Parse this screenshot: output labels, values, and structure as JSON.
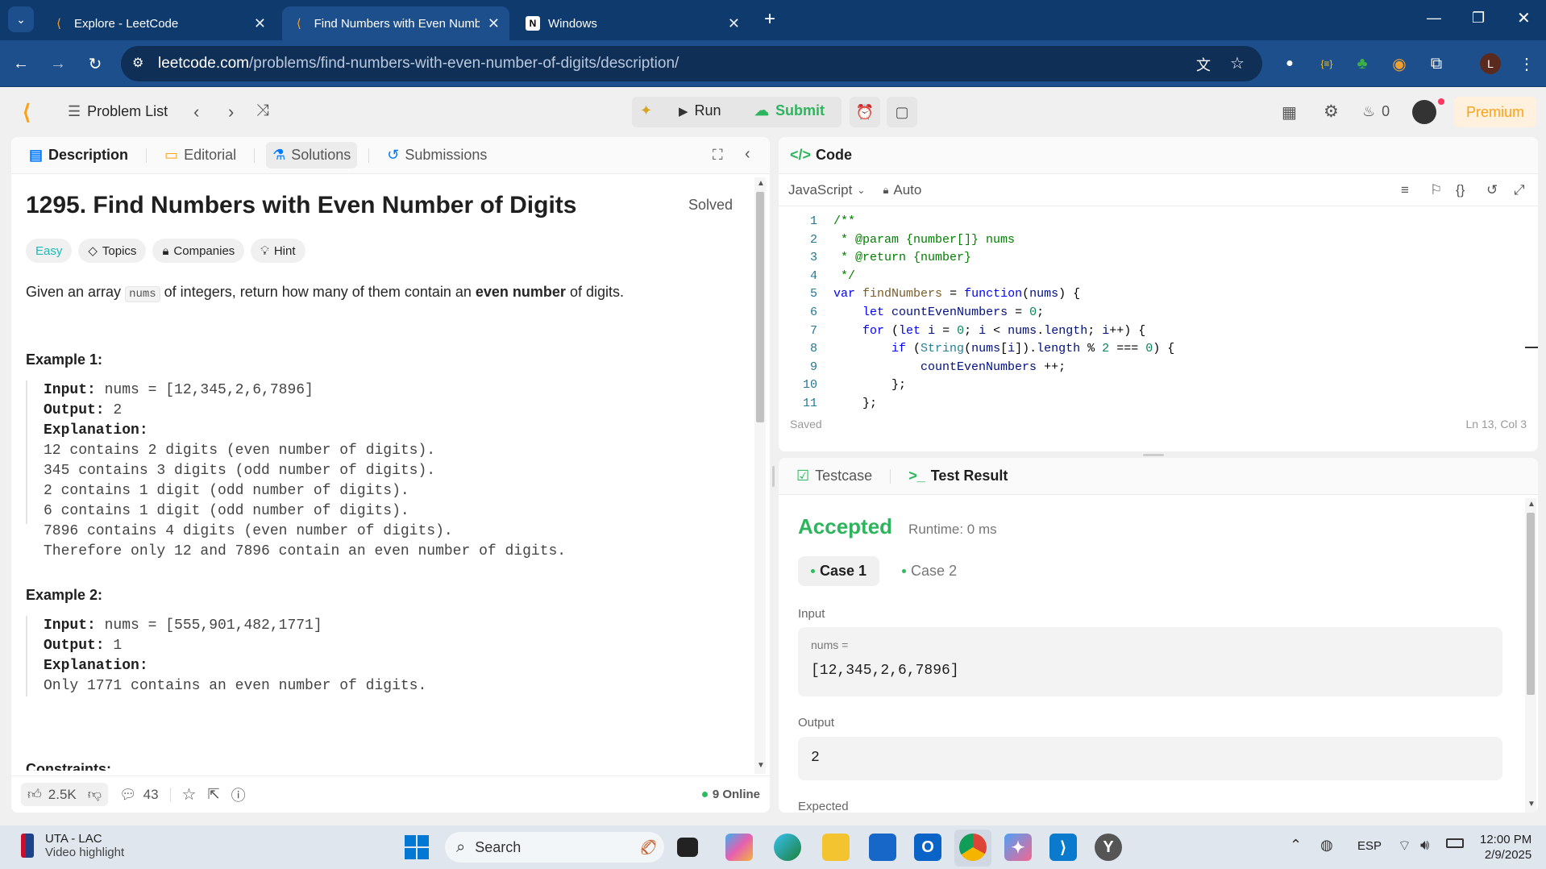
{
  "browser": {
    "tabs": [
      {
        "title": "Explore - LeetCode"
      },
      {
        "title": "Find Numbers with Even Numb"
      },
      {
        "title": "Windows"
      }
    ],
    "url_host": "leetcode.com",
    "url_path": "/problems/find-numbers-with-even-number-of-digits/description/",
    "profile_initial": "L"
  },
  "header": {
    "problem_list": "Problem List",
    "run": "Run",
    "submit": "Submit",
    "streak": "0",
    "premium": "Premium"
  },
  "left_tabs": {
    "description": "Description",
    "editorial": "Editorial",
    "solutions": "Solutions",
    "submissions": "Submissions"
  },
  "problem": {
    "title": "1295. Find Numbers with Even Number of Digits",
    "status": "Solved",
    "difficulty": "Easy",
    "topics": "Topics",
    "companies": "Companies",
    "hint": "Hint",
    "desc_before": "Given an array ",
    "desc_code": "nums",
    "desc_mid": " of integers, return how many of them contain an ",
    "desc_bold": "even number",
    "desc_after": " of digits.",
    "example1_title": "Example 1:",
    "example1": {
      "input_label": "Input:",
      "input": " nums = [12,345,2,6,7896]",
      "output_label": "Output:",
      "output": " 2",
      "explanation_label": "Explanation:",
      "explanation": "12 contains 2 digits (even number of digits). \n345 contains 3 digits (odd number of digits). \n2 contains 1 digit (odd number of digits). \n6 contains 1 digit (odd number of digits). \n7896 contains 4 digits (even number of digits). \nTherefore only 12 and 7896 contain an even number of digits."
    },
    "example2_title": "Example 2:",
    "example2": {
      "input_label": "Input:",
      "input": " nums = [555,901,482,1771]",
      "output_label": "Output:",
      "output": " 1",
      "explanation_label": "Explanation:",
      "explanation": "Only 1771 contains an even number of digits."
    },
    "constraints_title": "Constraints:"
  },
  "footer": {
    "likes": "2.5K",
    "comments": "43",
    "online": "9 Online"
  },
  "code_panel": {
    "title": "Code",
    "language": "JavaScript",
    "mode": "Auto",
    "saved": "Saved",
    "cursor": "Ln 13, Col 3",
    "line_numbers": [
      "1",
      "2",
      "3",
      "4",
      "5",
      "6",
      "7",
      "8",
      "9",
      "10",
      "11"
    ]
  },
  "result_panel": {
    "testcase_tab": "Testcase",
    "result_tab": "Test Result",
    "status": "Accepted",
    "runtime": "Runtime: 0 ms",
    "case1": "Case 1",
    "case2": "Case 2",
    "input_label": "Input",
    "input_var": "nums =",
    "input_value": "[12,345,2,6,7896]",
    "output_label": "Output",
    "output_value": "2",
    "expected_label": "Expected"
  },
  "taskbar": {
    "widget_title": "UTA - LAC",
    "widget_sub": "Video highlight",
    "search": "Search",
    "lang": "ESP",
    "time": "12:00 PM",
    "date": "2/9/2025"
  },
  "colors": {
    "accepted": "#2db55d",
    "submit": "#2db55d",
    "premium": "#ffa116",
    "tab_strip": "#0e3a6e",
    "toolbar": "#1d4f8d"
  }
}
